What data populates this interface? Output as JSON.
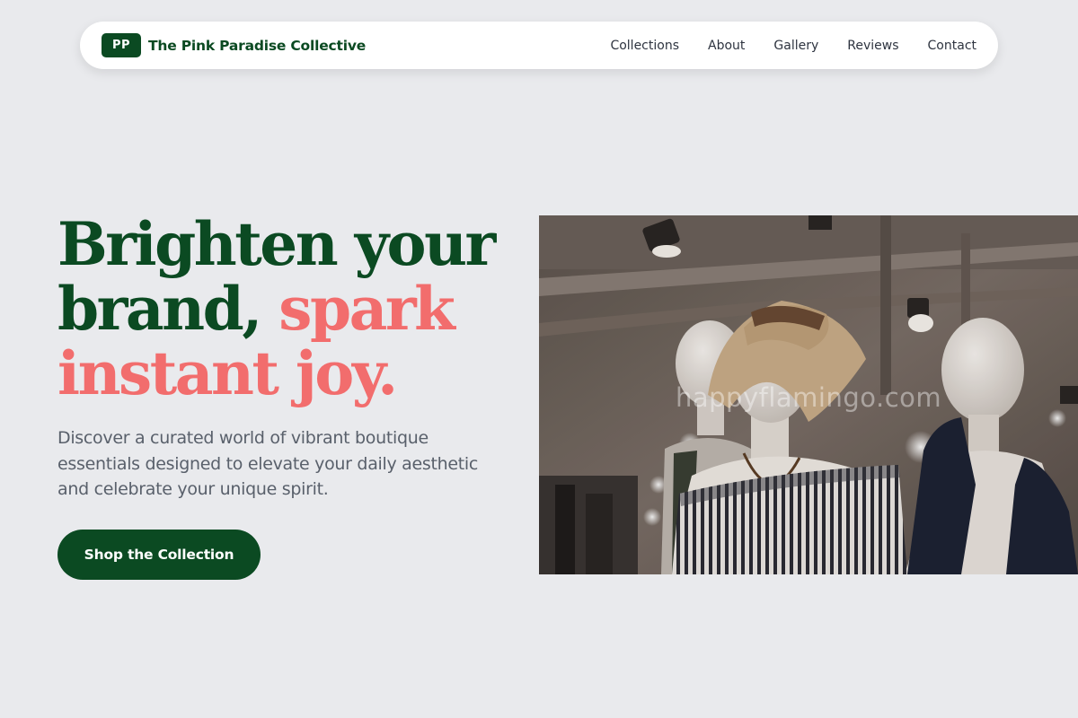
{
  "brand": {
    "logo_initials": "PP",
    "name": "The Pink Paradise Collective"
  },
  "nav": {
    "links": [
      {
        "label": "Collections"
      },
      {
        "label": "About"
      },
      {
        "label": "Gallery"
      },
      {
        "label": "Reviews"
      },
      {
        "label": "Contact"
      }
    ]
  },
  "hero": {
    "headline_part1": "Brighten your brand, ",
    "headline_accent": "spark instant joy.",
    "description": "Discover a curated world of vibrant boutique essentials designed to elevate your daily aesthetic and celebrate your unique spirit.",
    "cta_label": "Shop the Collection",
    "photo_watermark": "happyflamingo.com"
  },
  "colors": {
    "primary": "#0b4a22",
    "accent": "#f26d6d",
    "background": "#e9eaed",
    "body_text": "#59606b"
  }
}
